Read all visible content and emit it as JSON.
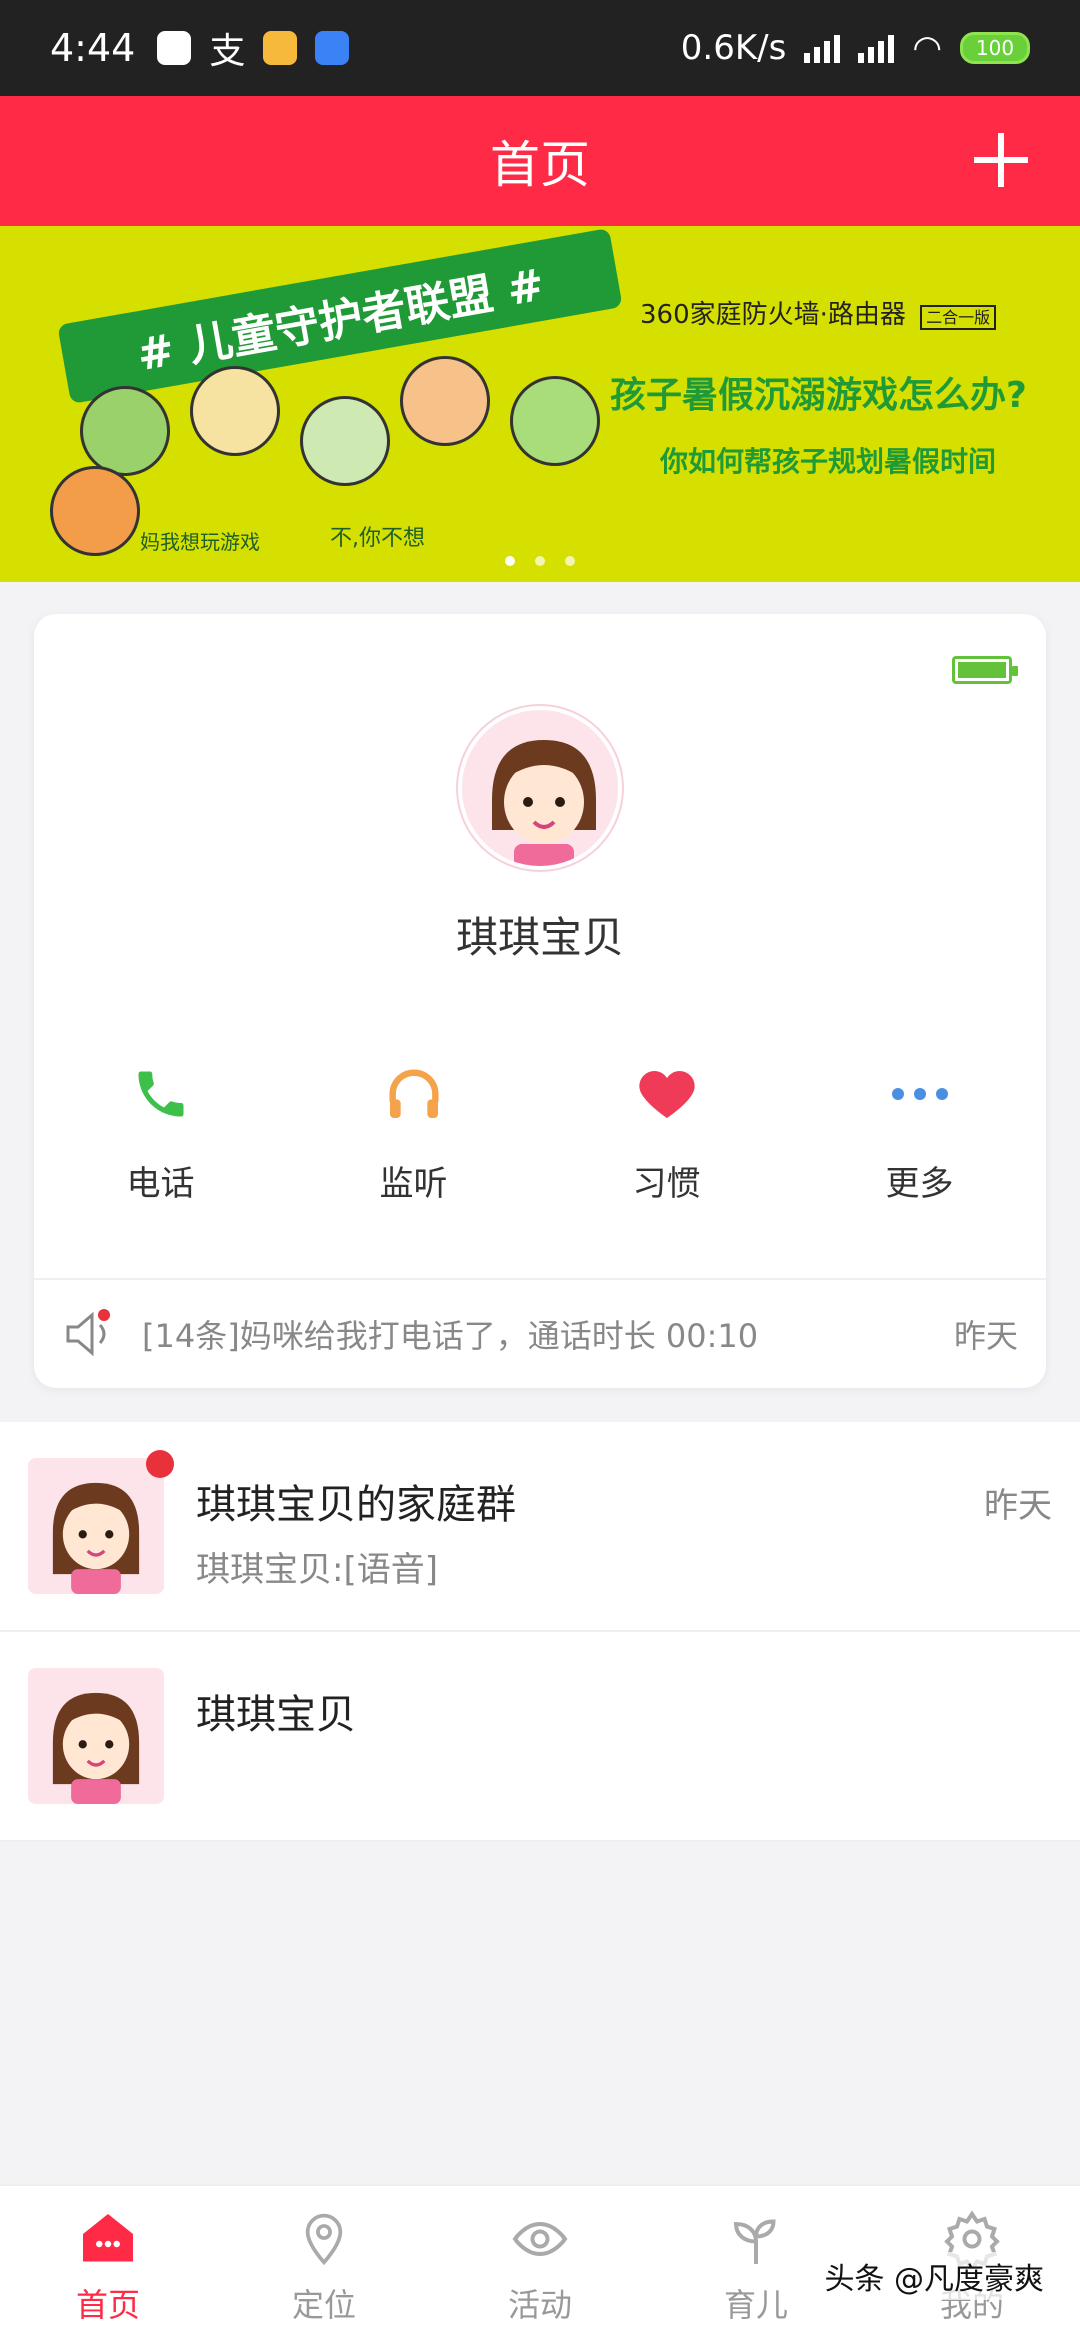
{
  "status_bar": {
    "time": "4:44",
    "network_speed": "0.6K/s",
    "battery": "100",
    "icons": [
      "qq-icon",
      "alipay-icon",
      "app-icon",
      "baidu-icon",
      "signal-hd-icon",
      "signal-icon",
      "wifi-icon"
    ]
  },
  "header": {
    "title": "首页",
    "add_icon": "plus-icon"
  },
  "banner": {
    "ribbon_text": "# 儿童守护者联盟 #",
    "brand": "360家庭防火墙·路由器",
    "brand_tag": "二合一版",
    "headline": "孩子暑假沉溺游戏怎么办?",
    "subheadline": "你如何帮孩子规划暑假时间",
    "caption_left": "妈我想玩游戏",
    "caption_mid": "不,你不想",
    "active_slide": 1,
    "slide_count": 3
  },
  "child_card": {
    "name": "琪琪宝贝",
    "battery_icon": "battery-full-icon",
    "actions": [
      {
        "label": "电话",
        "icon": "phone-icon",
        "color": "#3cc04a"
      },
      {
        "label": "监听",
        "icon": "headphones-icon",
        "color": "#f5a34a"
      },
      {
        "label": "习惯",
        "icon": "heart-icon",
        "color": "#ef3b58"
      },
      {
        "label": "更多",
        "icon": "more-dots-icon",
        "color": "#4a90e2"
      }
    ],
    "notice": {
      "text": "[14条]妈咪给我打电话了，通话时长 00:10",
      "time": "昨天"
    }
  },
  "chats": [
    {
      "title": "琪琪宝贝的家庭群",
      "subtitle": "琪琪宝贝:[语音]",
      "time": "昨天",
      "unread": true
    },
    {
      "title": "琪琪宝贝",
      "subtitle": "",
      "time": "",
      "unread": false
    }
  ],
  "bottom_nav": [
    {
      "label": "首页",
      "icon": "home-chat-icon",
      "active": true
    },
    {
      "label": "定位",
      "icon": "location-pin-icon",
      "active": false
    },
    {
      "label": "活动",
      "icon": "eye-icon",
      "active": false
    },
    {
      "label": "育儿",
      "icon": "sprout-icon",
      "active": false
    },
    {
      "label": "我的",
      "icon": "gear-icon",
      "active": false
    }
  ],
  "watermark": "头条 @凡度豪爽",
  "colors": {
    "brand_red": "#ff2a45",
    "banner_yellow_green": "#d6e000",
    "battery_green": "#64c23a"
  }
}
